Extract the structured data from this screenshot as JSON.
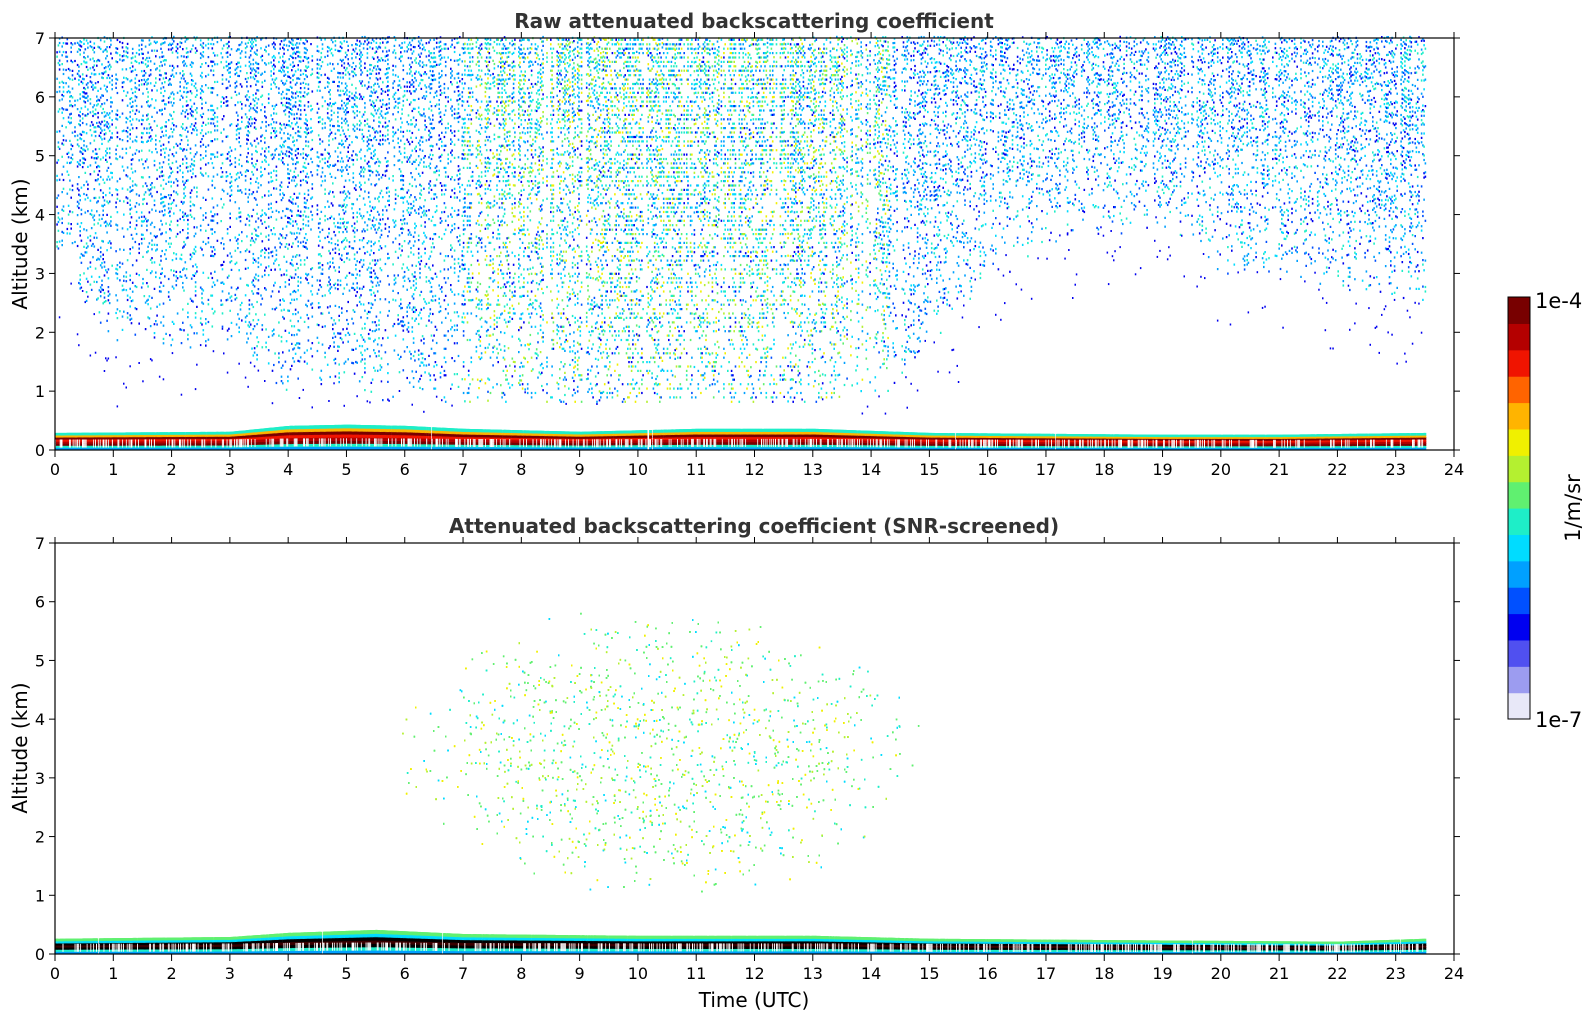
{
  "colors": {
    "colormap": [
      "#e8e8f8",
      "#9c9cf0",
      "#5050f0",
      "#0000f0",
      "#0050ff",
      "#00a0ff",
      "#00dcff",
      "#1eeec8",
      "#60f070",
      "#b4f030",
      "#f0f000",
      "#ffb400",
      "#ff6400",
      "#f01400",
      "#b40000",
      "#780000"
    ],
    "frame": "#000000",
    "title": "#333333"
  },
  "panels": [
    {
      "title": "Raw attenuated backscattering coefficient",
      "ylabel": "Altitude (km)",
      "xlabel": "",
      "xlim": [
        0,
        24
      ],
      "ylim": [
        0,
        7
      ],
      "xticks": [
        "0",
        "1",
        "2",
        "3",
        "4",
        "5",
        "6",
        "7",
        "8",
        "9",
        "10",
        "11",
        "12",
        "13",
        "14",
        "15",
        "16",
        "17",
        "18",
        "19",
        "20",
        "21",
        "22",
        "23",
        "24"
      ],
      "yticks": [
        "0",
        "1",
        "2",
        "3",
        "4",
        "5",
        "6",
        "7"
      ]
    },
    {
      "title": "Attenuated backscattering coefficient (SNR-screened)",
      "ylabel": "Altitude (km)",
      "xlabel": "Time (UTC)",
      "xlim": [
        0,
        24
      ],
      "ylim": [
        0,
        7
      ],
      "xticks": [
        "0",
        "1",
        "2",
        "3",
        "4",
        "5",
        "6",
        "7",
        "8",
        "9",
        "10",
        "11",
        "12",
        "13",
        "14",
        "15",
        "16",
        "17",
        "18",
        "19",
        "20",
        "21",
        "22",
        "23",
        "24"
      ],
      "yticks": [
        "0",
        "1",
        "2",
        "3",
        "4",
        "5",
        "6",
        "7"
      ]
    }
  ],
  "colorbar": {
    "label": "1/m/sr",
    "max_label": "1e-4",
    "min_label": "1e-7"
  },
  "chart_data": [
    {
      "type": "heatmap",
      "title": "Raw attenuated backscattering coefficient",
      "xlabel": "",
      "ylabel": "Altitude (km)",
      "xlim": [
        0,
        24
      ],
      "ylim": [
        0,
        7
      ],
      "x_unit": "hours UTC",
      "y_unit": "km",
      "data_coverage_hours": [
        0,
        23.5
      ],
      "color_scale": {
        "min": 1e-07,
        "max": 0.0001,
        "scale": "log",
        "units": "1/m/sr"
      },
      "boundary_layer_top_km": [
        [
          0,
          0.28
        ],
        [
          3,
          0.3
        ],
        [
          4,
          0.4
        ],
        [
          5,
          0.42
        ],
        [
          6,
          0.4
        ],
        [
          7,
          0.35
        ],
        [
          9,
          0.3
        ],
        [
          11,
          0.35
        ],
        [
          13,
          0.35
        ],
        [
          15,
          0.28
        ],
        [
          19,
          0.25
        ],
        [
          21,
          0.25
        ],
        [
          23.5,
          0.28
        ]
      ],
      "noise_lower_edge_km": [
        [
          0,
          3.5
        ],
        [
          1,
          2
        ],
        [
          3,
          1.8
        ],
        [
          4,
          1.2
        ],
        [
          6,
          1.1
        ],
        [
          7.5,
          0.8
        ],
        [
          9.5,
          0.7
        ],
        [
          11,
          0.6
        ],
        [
          12.5,
          0.7
        ],
        [
          14,
          1
        ],
        [
          15,
          2
        ],
        [
          16,
          3
        ],
        [
          17,
          3.8
        ],
        [
          19,
          4
        ],
        [
          20,
          3.2
        ],
        [
          22,
          3
        ],
        [
          23.5,
          2.7
        ]
      ],
      "grid": false,
      "legend": "colorbar right"
    },
    {
      "type": "heatmap",
      "title": "Attenuated backscattering coefficient (SNR-screened)",
      "xlabel": "Time (UTC)",
      "ylabel": "Altitude (km)",
      "xlim": [
        0,
        24
      ],
      "ylim": [
        0,
        7
      ],
      "x_unit": "hours UTC",
      "y_unit": "km",
      "data_coverage_hours": [
        0,
        23.5
      ],
      "color_scale": {
        "min": 1e-07,
        "max": 0.0001,
        "scale": "log",
        "units": "1/m/sr"
      },
      "boundary_layer_top_km": [
        [
          0,
          0.25
        ],
        [
          3,
          0.28
        ],
        [
          4,
          0.35
        ],
        [
          5.5,
          0.4
        ],
        [
          7,
          0.33
        ],
        [
          10,
          0.3
        ],
        [
          13,
          0.3
        ],
        [
          15,
          0.25
        ],
        [
          19,
          0.22
        ],
        [
          22,
          0.2
        ],
        [
          23.5,
          0.25
        ]
      ],
      "retained_noise_region": {
        "time_hours": [
          5.8,
          15
        ],
        "altitude_km": [
          0.9,
          6
        ]
      },
      "grid": false,
      "legend": "colorbar right"
    }
  ]
}
